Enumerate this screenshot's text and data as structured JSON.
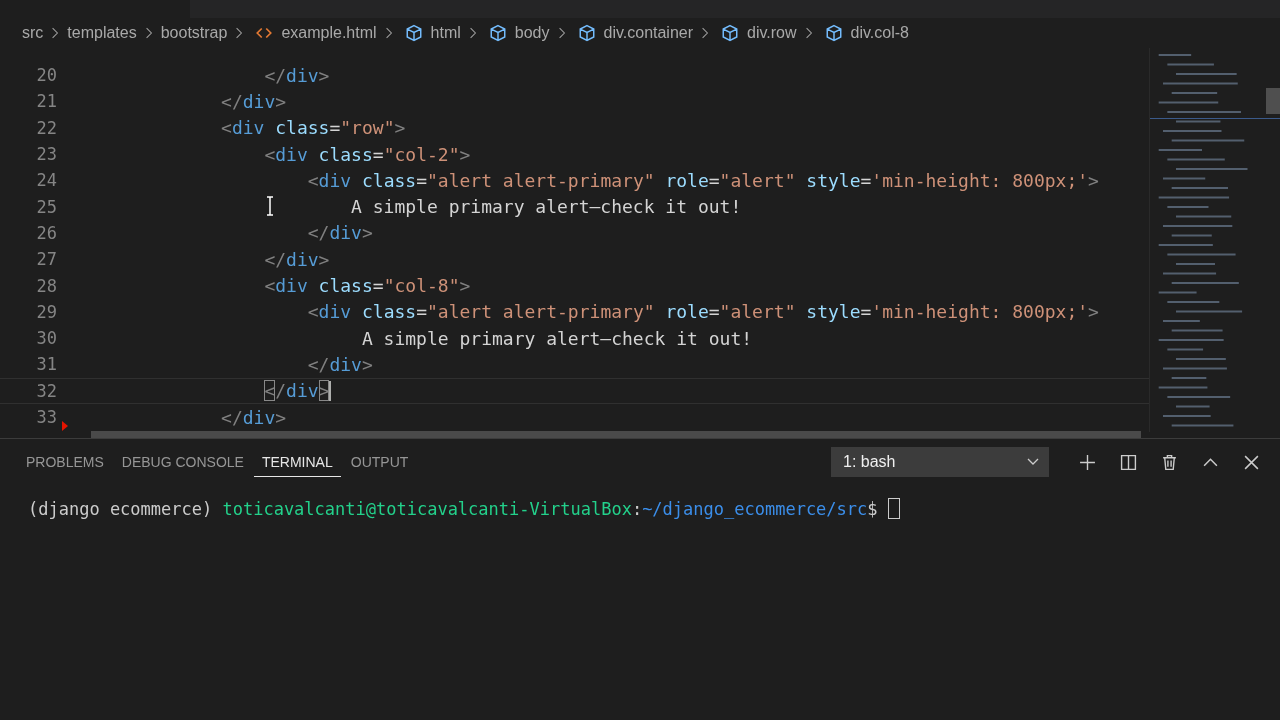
{
  "breadcrumb": [
    "src",
    "templates",
    "bootstrap",
    "example.html",
    "html",
    "body",
    "div.container",
    "div.row",
    "div.col-8"
  ],
  "editor": {
    "lines": [
      {
        "number": "20",
        "current": false,
        "deleted": false,
        "tokens": [
          {
            "kind": "bracket",
            "text": "                </"
          },
          {
            "kind": "tag",
            "text": "div"
          },
          {
            "kind": "bracket",
            "text": ">"
          }
        ]
      },
      {
        "number": "21",
        "current": false,
        "deleted": false,
        "tokens": [
          {
            "kind": "bracket",
            "text": "            </"
          },
          {
            "kind": "tag",
            "text": "div"
          },
          {
            "kind": "bracket",
            "text": ">"
          }
        ]
      },
      {
        "number": "22",
        "current": false,
        "deleted": false,
        "tokens": [
          {
            "kind": "bracket",
            "text": "            <"
          },
          {
            "kind": "tag",
            "text": "div"
          },
          {
            "kind": "attr",
            "text": " class"
          },
          {
            "kind": "plain",
            "text": "="
          },
          {
            "kind": "string",
            "text": "\"row\""
          },
          {
            "kind": "bracket",
            "text": ">"
          }
        ]
      },
      {
        "number": "23",
        "current": false,
        "deleted": false,
        "tokens": [
          {
            "kind": "bracket",
            "text": "                <"
          },
          {
            "kind": "tag",
            "text": "div"
          },
          {
            "kind": "attr",
            "text": " class"
          },
          {
            "kind": "plain",
            "text": "="
          },
          {
            "kind": "string",
            "text": "\"col-2\""
          },
          {
            "kind": "bracket",
            "text": ">"
          }
        ]
      },
      {
        "number": "24",
        "current": false,
        "deleted": false,
        "tokens": [
          {
            "kind": "bracket",
            "text": "                    <"
          },
          {
            "kind": "tag",
            "text": "div"
          },
          {
            "kind": "attr",
            "text": " class"
          },
          {
            "kind": "plain",
            "text": "="
          },
          {
            "kind": "string",
            "text": "\"alert alert-primary\""
          },
          {
            "kind": "attr",
            "text": " role"
          },
          {
            "kind": "plain",
            "text": "="
          },
          {
            "kind": "string",
            "text": "\"alert\""
          },
          {
            "kind": "attr",
            "text": " style"
          },
          {
            "kind": "plain",
            "text": "="
          },
          {
            "kind": "string",
            "text": "'min-height: 800px;'"
          },
          {
            "kind": "bracket",
            "text": ">"
          }
        ]
      },
      {
        "number": "25",
        "current": false,
        "deleted": false,
        "tokens": [
          {
            "kind": "plain",
            "text": "                        A simple primary alert—check it out!"
          }
        ]
      },
      {
        "number": "26",
        "current": false,
        "deleted": false,
        "tokens": [
          {
            "kind": "bracket",
            "text": "                    </"
          },
          {
            "kind": "tag",
            "text": "div"
          },
          {
            "kind": "bracket",
            "text": ">"
          }
        ]
      },
      {
        "number": "27",
        "current": false,
        "deleted": false,
        "tokens": [
          {
            "kind": "bracket",
            "text": "                </"
          },
          {
            "kind": "tag",
            "text": "div"
          },
          {
            "kind": "bracket",
            "text": ">"
          }
        ]
      },
      {
        "number": "28",
        "current": false,
        "deleted": false,
        "tokens": [
          {
            "kind": "bracket",
            "text": "                <"
          },
          {
            "kind": "tag",
            "text": "div"
          },
          {
            "kind": "attr",
            "text": " class"
          },
          {
            "kind": "plain",
            "text": "="
          },
          {
            "kind": "string",
            "text": "\"col-8\""
          },
          {
            "kind": "bracket",
            "text": ">"
          }
        ]
      },
      {
        "number": "29",
        "current": false,
        "deleted": false,
        "tokens": [
          {
            "kind": "bracket",
            "text": "                    <"
          },
          {
            "kind": "tag",
            "text": "div"
          },
          {
            "kind": "attr",
            "text": " class"
          },
          {
            "kind": "plain",
            "text": "="
          },
          {
            "kind": "string",
            "text": "\"alert alert-primary\""
          },
          {
            "kind": "attr",
            "text": " role"
          },
          {
            "kind": "plain",
            "text": "="
          },
          {
            "kind": "string",
            "text": "\"alert\""
          },
          {
            "kind": "attr",
            "text": " style"
          },
          {
            "kind": "plain",
            "text": "="
          },
          {
            "kind": "string",
            "text": "'min-height: 800px;'"
          },
          {
            "kind": "bracket",
            "text": ">"
          }
        ]
      },
      {
        "number": "30",
        "current": false,
        "deleted": false,
        "tokens": [
          {
            "kind": "plain",
            "text": "                         A simple primary alert—check it out!"
          }
        ]
      },
      {
        "number": "31",
        "current": false,
        "deleted": false,
        "tokens": [
          {
            "kind": "bracket",
            "text": "                    </"
          },
          {
            "kind": "tag",
            "text": "div"
          },
          {
            "kind": "bracket",
            "text": ">"
          }
        ]
      },
      {
        "number": "32",
        "current": true,
        "deleted": false,
        "tokens": [
          {
            "kind": "match",
            "text": "<"
          },
          {
            "kind": "bracket",
            "text": "/"
          },
          {
            "kind": "tag",
            "text": "div"
          },
          {
            "kind": "match",
            "text": ">"
          }
        ]
      },
      {
        "number": "33",
        "current": false,
        "deleted": true,
        "tokens": [
          {
            "kind": "bracket",
            "text": "            </"
          },
          {
            "kind": "tag",
            "text": "div"
          },
          {
            "kind": "bracket",
            "text": ">"
          }
        ]
      }
    ]
  },
  "panel": {
    "tabs": [
      {
        "label": "PROBLEMS",
        "selected": false
      },
      {
        "label": "DEBUG CONSOLE",
        "selected": false
      },
      {
        "label": "TERMINAL",
        "selected": true
      },
      {
        "label": "OUTPUT",
        "selected": false
      }
    ],
    "terminal_select": "1: bash",
    "prompt": [
      {
        "kind": "plain",
        "text": "(django ecommerce) "
      },
      {
        "kind": "user",
        "text": "toticavalcanti@toticavalcanti-VirtualBox"
      },
      {
        "kind": "plain",
        "text": ":"
      },
      {
        "kind": "path",
        "text": "~/django_ecommerce/src"
      },
      {
        "kind": "plain",
        "text": "$"
      }
    ]
  }
}
